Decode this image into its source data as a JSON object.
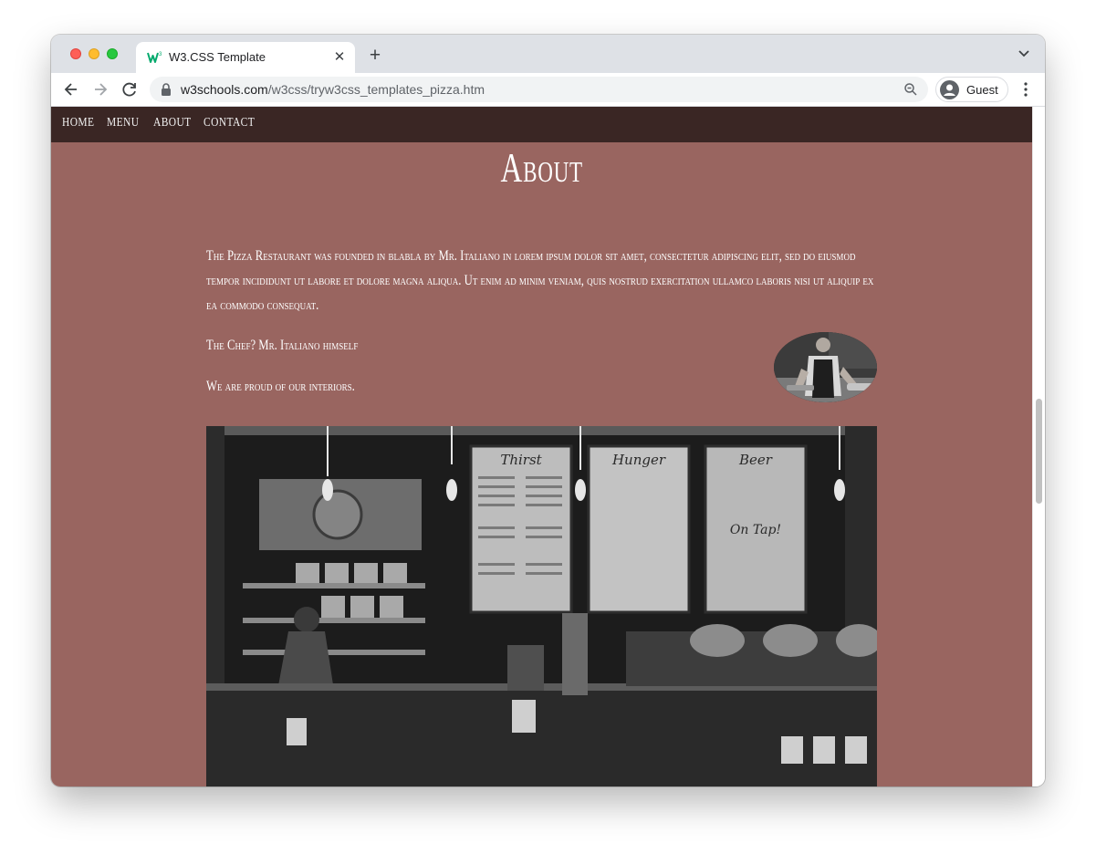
{
  "browser": {
    "tab_title": "W3.CSS Template",
    "new_tab_label": "+",
    "url_host": "w3schools.com",
    "url_path": "/w3css/tryw3css_templates_pizza.htm",
    "profile_label": "Guest"
  },
  "site": {
    "nav": [
      "HOME",
      "MENU",
      "ABOUT",
      "CONTACT"
    ],
    "heading": "About",
    "intro": "The Pizza Restaurant was founded in blabla by Mr. Italiano in lorem ipsum dolor sit amet, consectetur adipiscing elit, sed do eiusmod tempor incididunt ut labore et dolore magna aliqua. Ut enim ad minim veniam, quis nostrud exercitation ullamco laboris nisi ut aliquip ex ea commodo consequat.",
    "chef_line": "The Chef? Mr. Italiano himself",
    "interiors_line": "We are proud of our interiors.",
    "board_titles": [
      "Thirst",
      "Hunger",
      "Beer"
    ],
    "board_on_tap": "On Tap!"
  },
  "colors": {
    "page_bg": "#996560",
    "nav_bg": "#3a2624",
    "text": "#ffffff"
  },
  "icons": [
    "w3schools-favicon",
    "close-icon",
    "plus-icon",
    "chevron-down-icon",
    "back-arrow-icon",
    "forward-arrow-icon",
    "reload-icon",
    "lock-icon",
    "zoom-icon",
    "avatar-icon",
    "kebab-menu-icon"
  ]
}
